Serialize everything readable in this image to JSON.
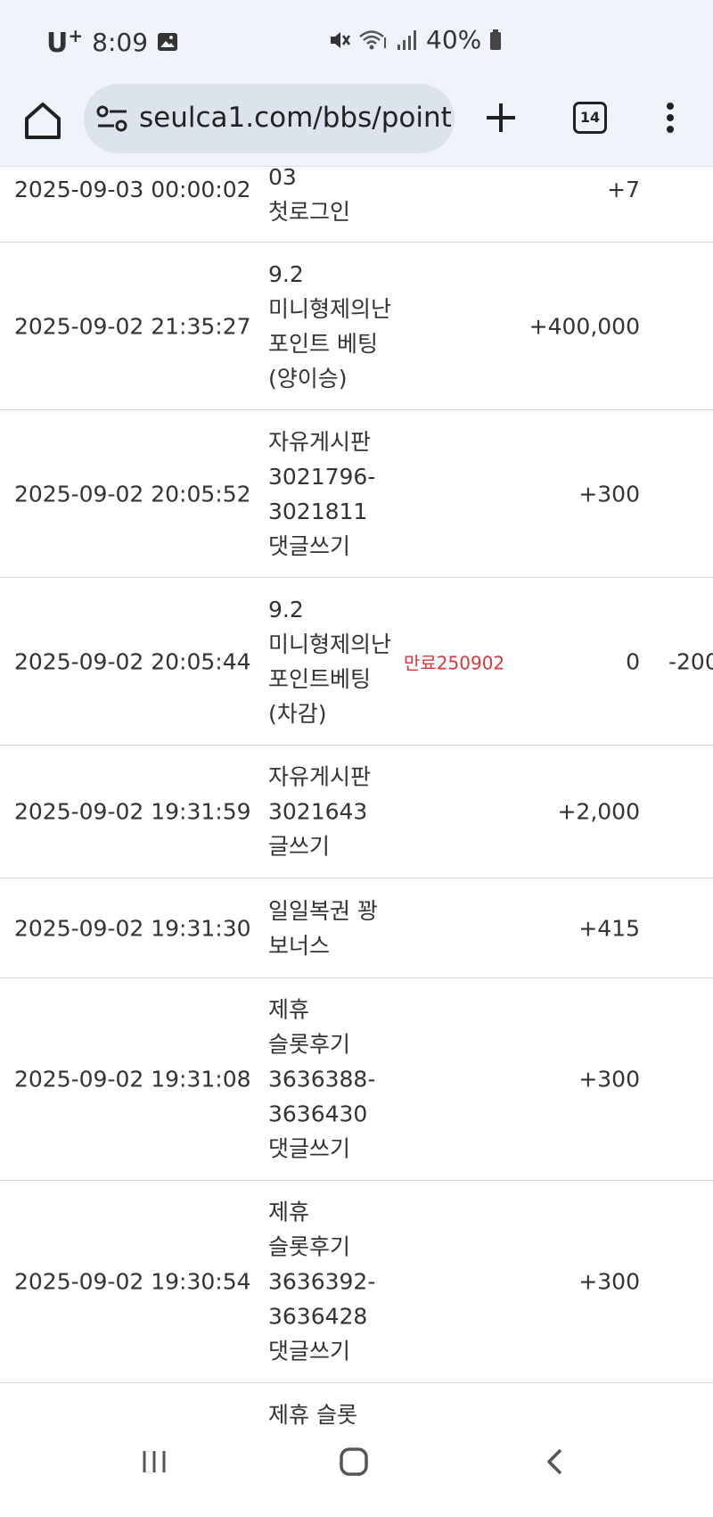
{
  "status_bar": {
    "carrier": "U",
    "carrier_sup": "+",
    "time": "8:09",
    "battery": "40%",
    "icons": [
      "image-icon",
      "mute-icon",
      "wifi-icon",
      "signal-icon",
      "battery-icon"
    ]
  },
  "browser": {
    "url": "seulca1.com/bbs/point",
    "tab_count": "14"
  },
  "rows": [
    {
      "date": "2025-09-03 00:00:02",
      "content": "03 첫로그인",
      "expire": "",
      "point": "+7",
      "used": ""
    },
    {
      "date": "2025-09-02 21:35:27",
      "content": "9.2 미니형제의난 포인트 베팅(양이승)",
      "expire": "",
      "point": "+400,000",
      "used": ""
    },
    {
      "date": "2025-09-02 20:05:52",
      "content": "자유게시판 3021796-3021811 댓글쓰기",
      "expire": "",
      "point": "+300",
      "used": ""
    },
    {
      "date": "2025-09-02 20:05:44",
      "content": "9.2 미니형제의난 포인트베팅(차감)",
      "expire": "만료250902",
      "point": "0",
      "used": "-200"
    },
    {
      "date": "2025-09-02 19:31:59",
      "content": "자유게시판 3021643 글쓰기",
      "expire": "",
      "point": "+2,000",
      "used": ""
    },
    {
      "date": "2025-09-02 19:31:30",
      "content": "일일복권 꽝 보너스",
      "expire": "",
      "point": "+415",
      "used": ""
    },
    {
      "date": "2025-09-02 19:31:08",
      "content": "제휴 슬롯후기 3636388-3636430 댓글쓰기",
      "expire": "",
      "point": "+300",
      "used": ""
    },
    {
      "date": "2025-09-02 19:30:54",
      "content": "제휴 슬롯후기 3636392-3636428 댓글쓰기",
      "expire": "",
      "point": "+300",
      "used": ""
    },
    {
      "date": "",
      "content": "제휴 슬롯",
      "expire": "",
      "point": "",
      "used": ""
    }
  ],
  "colors": {
    "chrome_bg": "#eff4fb",
    "url_pill": "#dde3ec",
    "expire_red": "#d9363e",
    "divider": "#d6d6d6"
  }
}
